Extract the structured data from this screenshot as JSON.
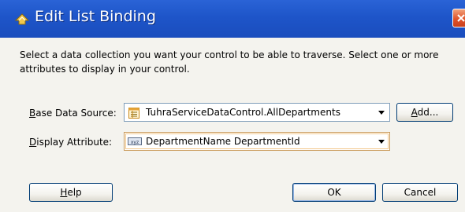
{
  "window": {
    "title": "Edit List Binding",
    "title_icon": "puzzle-dialog-icon",
    "close_icon": "close-icon"
  },
  "instructions": "Select a data collection you want your control to be able to traverse. Select one or more attributes to display in your control.",
  "base_data_source": {
    "label_mnemonic": "B",
    "label_rest": "ase Data Source:",
    "value": "TuhraServiceDataControl.AllDepartments",
    "icon": "data-collection-icon"
  },
  "add_button": {
    "label_mnemonic": "A",
    "label_rest": "dd..."
  },
  "display_attribute": {
    "label_mnemonic": "D",
    "label_rest": "isplay Attribute:",
    "value": "DepartmentName DepartmentId",
    "icon": "xyz-attribute-icon"
  },
  "buttons": {
    "help_mnemonic": "H",
    "help_rest": "elp",
    "ok": "OK",
    "cancel": "Cancel"
  }
}
